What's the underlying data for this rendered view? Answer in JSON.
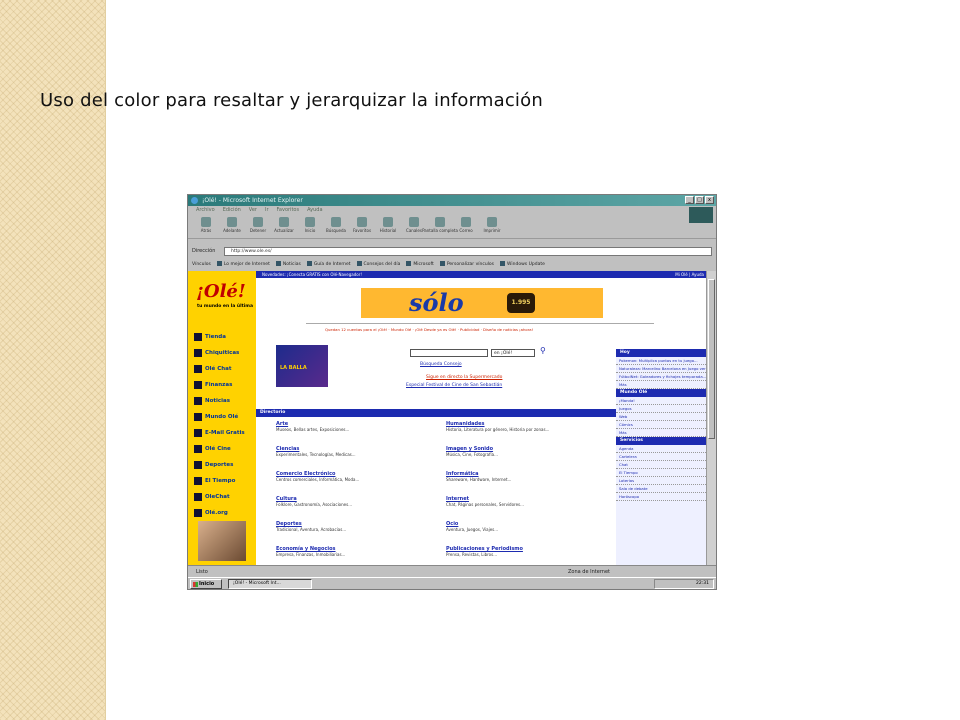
{
  "slide": {
    "title": "Uso del color para resaltar y jerarquizar la información"
  },
  "browser": {
    "window_title": "¡Olé! - Microsoft Internet Explorer",
    "menu": [
      "Archivo",
      "Edición",
      "Ver",
      "Ir",
      "Favoritos",
      "Ayuda"
    ],
    "toolbar": [
      "Atrás",
      "Adelante",
      "Detener",
      "Actualizar",
      "Inicio",
      "Búsqueda",
      "Favoritos",
      "Historial",
      "Canales",
      "Pantalla completa",
      "Correo",
      "Imprimir"
    ],
    "address_label": "Dirección",
    "address_value": "http://www.ole.es/",
    "links_label": "Vínculos",
    "links": [
      "Lo mejor de Internet",
      "Noticias",
      "Guía de Internet",
      "Consejos del día",
      "Microsoft",
      "Personalizar vínculos",
      "Windows Update"
    ],
    "status_text": "Listo",
    "status_zone": "Zona de Internet",
    "taskbar_start": "Inicio",
    "taskbar_item": "¡Olé! - Microsoft Int...",
    "tray_time": "22:31"
  },
  "page": {
    "logo": "¡Olé!",
    "tagline": "tu mundo en la ûltima",
    "nav": [
      "Tienda",
      "Chiquiticas",
      "Olé Chat",
      "Finanzas",
      "Noticias",
      "Mundo Olé",
      "E-Mail Gratis",
      "Olé Cine",
      "Deportes",
      "El Tiempo",
      "OleChat",
      "Olé.org"
    ],
    "news_strip": "Novedades: ¡Conecta GRATIS con Olé-Navegador!",
    "news_strip_right": "Mi Olé | Ayuda",
    "banner": {
      "text": "sólo",
      "price": "1.995"
    },
    "promo_links": "Quedan 12 cuentas para el ¡Olé! · Mundo Olé · ¡Olé Desde ya es Olé! · Publicidad · Diseño de noticias ¡ahora!",
    "laballa_label": "LA BALLA",
    "search": {
      "select": "en ¡Olé!",
      "tabs": "Búsqueda   Consejo",
      "promo1": "Sigue en directo la Supermercado",
      "promo2": "Especial Festival de Cine de San Sebastián"
    },
    "directory_title": "Directorio",
    "directory": {
      "left": [
        {
          "h": "Arte",
          "s": "Museos, Bellas artes, Exposiciones..."
        },
        {
          "h": "Ciencias",
          "s": "Experimentales, Tecnologías, Medicas..."
        },
        {
          "h": "Comercio Electrónico",
          "s": "Centros comerciales, Informática, Moda..."
        },
        {
          "h": "Cultura",
          "s": "Folklore, Gastronomía, Asociaciones..."
        },
        {
          "h": "Deportes",
          "s": "Tradicional, Aventura, Acrobacias..."
        },
        {
          "h": "Economía y Negocios",
          "s": "Empresa, Finanzas, Inmobiliarias..."
        }
      ],
      "right": [
        {
          "h": "Humanidades",
          "s": "Historia, Literatura por género, Historia por zonas..."
        },
        {
          "h": "Imagen y Sonido",
          "s": "Música, Cine, Fotografía..."
        },
        {
          "h": "Informática",
          "s": "Shareware, Hardware, Internet..."
        },
        {
          "h": "Internet",
          "s": "Chat, Páginas personales, Servidores..."
        },
        {
          "h": "Ocio",
          "s": "Aventura, Juegos, Viajes..."
        },
        {
          "h": "Publicaciones y Periodismo",
          "s": "Prensa, Revistas, Libros..."
        }
      ]
    },
    "right_col": {
      "hoy_title": "Hoy",
      "hoy_items": [
        "Pokemon: Multiplica puntos en tu juego...",
        "Naturaleza: Marcelino Barcelona en Juego verano...",
        "FútbolNet: Goleadores y fichajes temporada...",
        "Más"
      ],
      "mundo_title": "Mundo Olé",
      "mundo_items": [
        "¡Manda!",
        "Juegos",
        "Web",
        "Cómics",
        "Más"
      ],
      "servicios_title": "Servicios",
      "servicios_items": [
        "Agenda",
        "Cartelera",
        "Chat",
        "El Tiempo",
        "Loterías",
        "Sala de debate",
        "Horóscopo"
      ]
    }
  }
}
